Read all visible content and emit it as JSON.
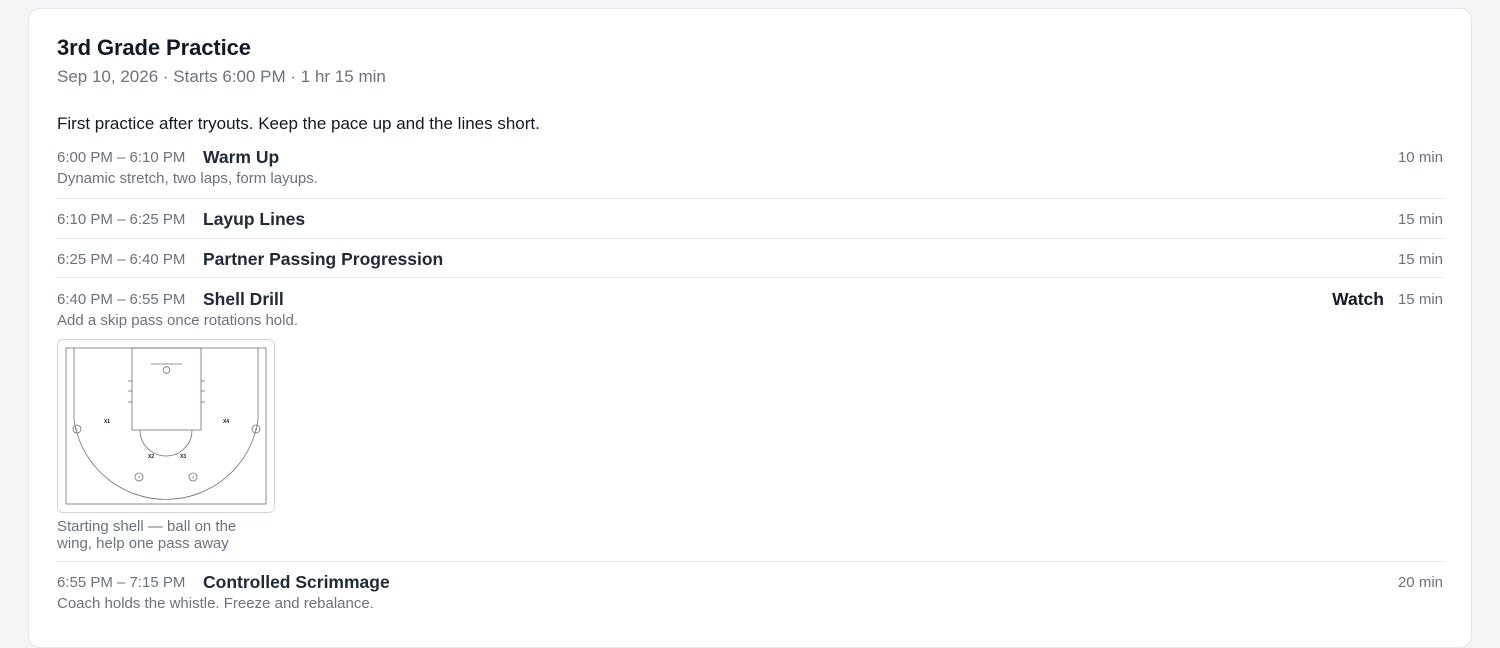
{
  "practice": {
    "title": "3rd Grade Practice",
    "subtitle": "Sep 10, 2026 · Starts 6:00 PM · 1 hr 15 min",
    "intro": "First practice after tryouts. Keep the pace up and the lines short."
  },
  "items": [
    {
      "time": "6:00 PM – 6:10 PM",
      "name": "Warm Up",
      "duration": "10 min",
      "note": "Dynamic stretch, two laps, form layups."
    },
    {
      "time": "6:10 PM – 6:25 PM",
      "name": "Layup Lines",
      "duration": "15 min"
    },
    {
      "time": "6:25 PM – 6:40 PM",
      "name": "Partner Passing Progression",
      "duration": "15 min"
    },
    {
      "time": "6:40 PM – 6:55 PM",
      "name": "Shell Drill",
      "duration": "15 min",
      "watch": "Watch",
      "note": "Add a skip pass once rotations hold.",
      "diagram": {
        "defenders": [
          "X1",
          "X2",
          "X3",
          "X4"
        ],
        "offense": [
          "1",
          "2",
          "3",
          "4"
        ],
        "caption": "Starting shell — ball on the wing, help one pass away"
      }
    },
    {
      "time": "6:55 PM – 7:15 PM",
      "name": "Controlled Scrimmage",
      "duration": "20 min",
      "note": "Coach holds the whistle. Freeze and rebalance."
    }
  ],
  "colors": {
    "page_bg": "#f3f4f6",
    "card_bg": "#ffffff",
    "text_primary": "#111827",
    "text_muted": "#6b7280",
    "divider": "#e5e7eb"
  }
}
